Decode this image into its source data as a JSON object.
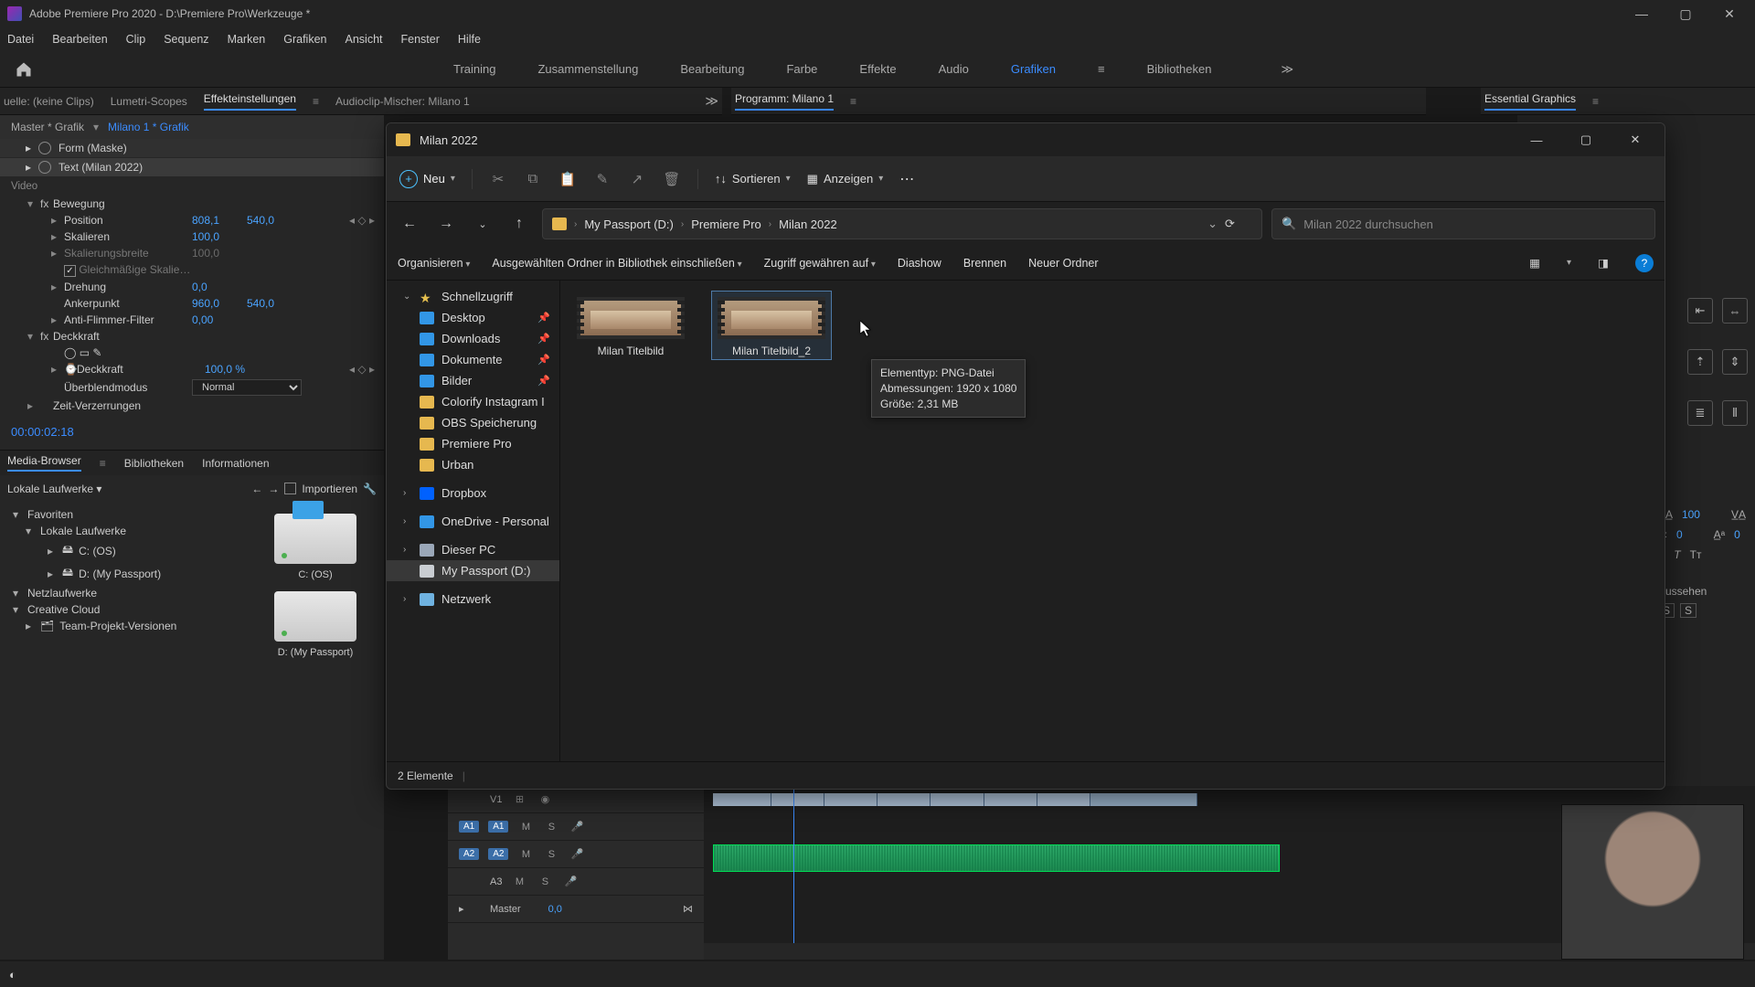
{
  "premiere": {
    "title": "Adobe Premiere Pro 2020 - D:\\Premiere Pro\\Werkzeuge *",
    "menus": [
      "Datei",
      "Bearbeiten",
      "Clip",
      "Sequenz",
      "Marken",
      "Grafiken",
      "Ansicht",
      "Fenster",
      "Hilfe"
    ],
    "workspaces": [
      "Training",
      "Zusammenstellung",
      "Bearbeitung",
      "Farbe",
      "Effekte",
      "Audio",
      "Grafiken",
      "Bibliotheken"
    ],
    "workspace_active_index": 6,
    "top_tabs_left": [
      "uelle: (keine Clips)",
      "Lumetri-Scopes",
      "Effekteinstellungen",
      "Audioclip-Mischer: Milano 1"
    ],
    "top_tabs_left_active": 2,
    "top_tabs_center": "Programm: Milano 1",
    "top_tabs_right": "Essential Graphics",
    "ec": {
      "master": "Master * Grafik",
      "clip": "Milano 1 * Grafik",
      "layers": [
        {
          "name": "Form (Maske)",
          "selected": false
        },
        {
          "name": "Text (Milan 2022)",
          "selected": true
        }
      ],
      "video_label": "Video",
      "groups": [
        {
          "name": "Bewegung",
          "fx": true,
          "children": [
            {
              "name": "Position",
              "v1": "808,1",
              "v2": "540,0",
              "kf": true
            },
            {
              "name": "Skalieren",
              "v1": "100,0"
            },
            {
              "name": "Skalierungsbreite",
              "v1": "100,0",
              "dim": true
            },
            {
              "name": "Gleichmäßige Skalie…",
              "checkbox": true,
              "checked": true,
              "dim": true
            },
            {
              "name": "Drehung",
              "v1": "0,0"
            },
            {
              "name": "Ankerpunkt",
              "v1": "960,0",
              "v2": "540,0"
            },
            {
              "name": "Anti-Flimmer-Filter",
              "v1": "0,00"
            }
          ]
        },
        {
          "name": "Deckkraft",
          "fx": true,
          "tools": true,
          "children": [
            {
              "name": "Deckkraft",
              "v1": "100,0 %",
              "kf": true
            },
            {
              "name": "Überblendmodus",
              "select": "Normal"
            }
          ]
        },
        {
          "name": "Zeit-Verzerrungen"
        }
      ],
      "timecode": "00:00:02:18"
    },
    "mb": {
      "tabs": [
        "Media-Browser",
        "Bibliotheken",
        "Informationen"
      ],
      "active": 0,
      "tool_label": "Lokale Laufwerke",
      "import_label": "Importieren",
      "tree": [
        {
          "label": "Favoriten",
          "tw": "▾"
        },
        {
          "label": "Lokale Laufwerke",
          "tw": "▾",
          "l": 1
        },
        {
          "label": "C: (OS)",
          "tw": "▸",
          "l": 2,
          "drive": true
        },
        {
          "label": "D: (My Passport)",
          "tw": "▸",
          "l": 2,
          "drive": true
        },
        {
          "label": "Netzlaufwerke",
          "tw": "▾"
        },
        {
          "label": "Creative Cloud",
          "tw": "▾"
        },
        {
          "label": "Team-Projekt-Versionen",
          "tw": "▸",
          "l": 1
        }
      ],
      "drive1": "C: (OS)",
      "drive2": "D: (My Passport)"
    },
    "timeline": {
      "tracks": [
        {
          "tag": "",
          "name": "V1",
          "btns": [
            "⊞",
            "◉"
          ]
        },
        {
          "tag": "A1",
          "name": "A1",
          "btns": [
            "M",
            "S",
            "🎤"
          ],
          "active": true
        },
        {
          "tag": "A2",
          "name": "A2",
          "btns": [
            "M",
            "S",
            "🎤"
          ],
          "active": true
        },
        {
          "tag": "",
          "name": "A3",
          "btns": [
            "M",
            "S",
            "🎤"
          ]
        },
        {
          "tag": "",
          "name": "Master",
          "val": "0,0"
        }
      ]
    },
    "right": {
      "text_label": "Aussehen",
      "va": "100",
      "a0": "0",
      "t0": "0"
    }
  },
  "explorer": {
    "title": "Milan 2022",
    "neu": "Neu",
    "sort": "Sortieren",
    "view": "Anzeigen",
    "crumbs": [
      "My Passport (D:)",
      "Premiere Pro",
      "Milan 2022"
    ],
    "search_placeholder": "Milan 2022 durchsuchen",
    "cmds": {
      "organize": "Organisieren",
      "library": "Ausgewählten Ordner in Bibliothek einschließen",
      "access": "Zugriff gewähren auf",
      "slideshow": "Diashow",
      "burn": "Brennen",
      "newfolder": "Neuer Ordner"
    },
    "sidebar": {
      "quick": "Schnellzugriff",
      "items": [
        {
          "name": "Desktop",
          "pin": true,
          "ico": "blue"
        },
        {
          "name": "Downloads",
          "pin": true,
          "ico": "blue"
        },
        {
          "name": "Dokumente",
          "pin": true,
          "ico": "blue"
        },
        {
          "name": "Bilder",
          "pin": true,
          "ico": "blue"
        },
        {
          "name": "Colorify Instagram I",
          "ico": "folder"
        },
        {
          "name": "OBS Speicherung",
          "ico": "folder"
        },
        {
          "name": "Premiere Pro",
          "ico": "folder"
        },
        {
          "name": "Urban",
          "ico": "folder"
        }
      ],
      "dropbox": "Dropbox",
      "onedrive": "OneDrive - Personal",
      "thispc": "Dieser PC",
      "drive": "My Passport (D:)",
      "network": "Netzwerk"
    },
    "files": [
      {
        "name": "Milan Titelbild"
      },
      {
        "name": "Milan Titelbild_2",
        "selected": true
      }
    ],
    "tooltip": {
      "l1": "Elementtyp: PNG-Datei",
      "l2": "Abmessungen: 1920 x 1080",
      "l3": "Größe: 2,31 MB"
    },
    "status": "2 Elemente"
  }
}
